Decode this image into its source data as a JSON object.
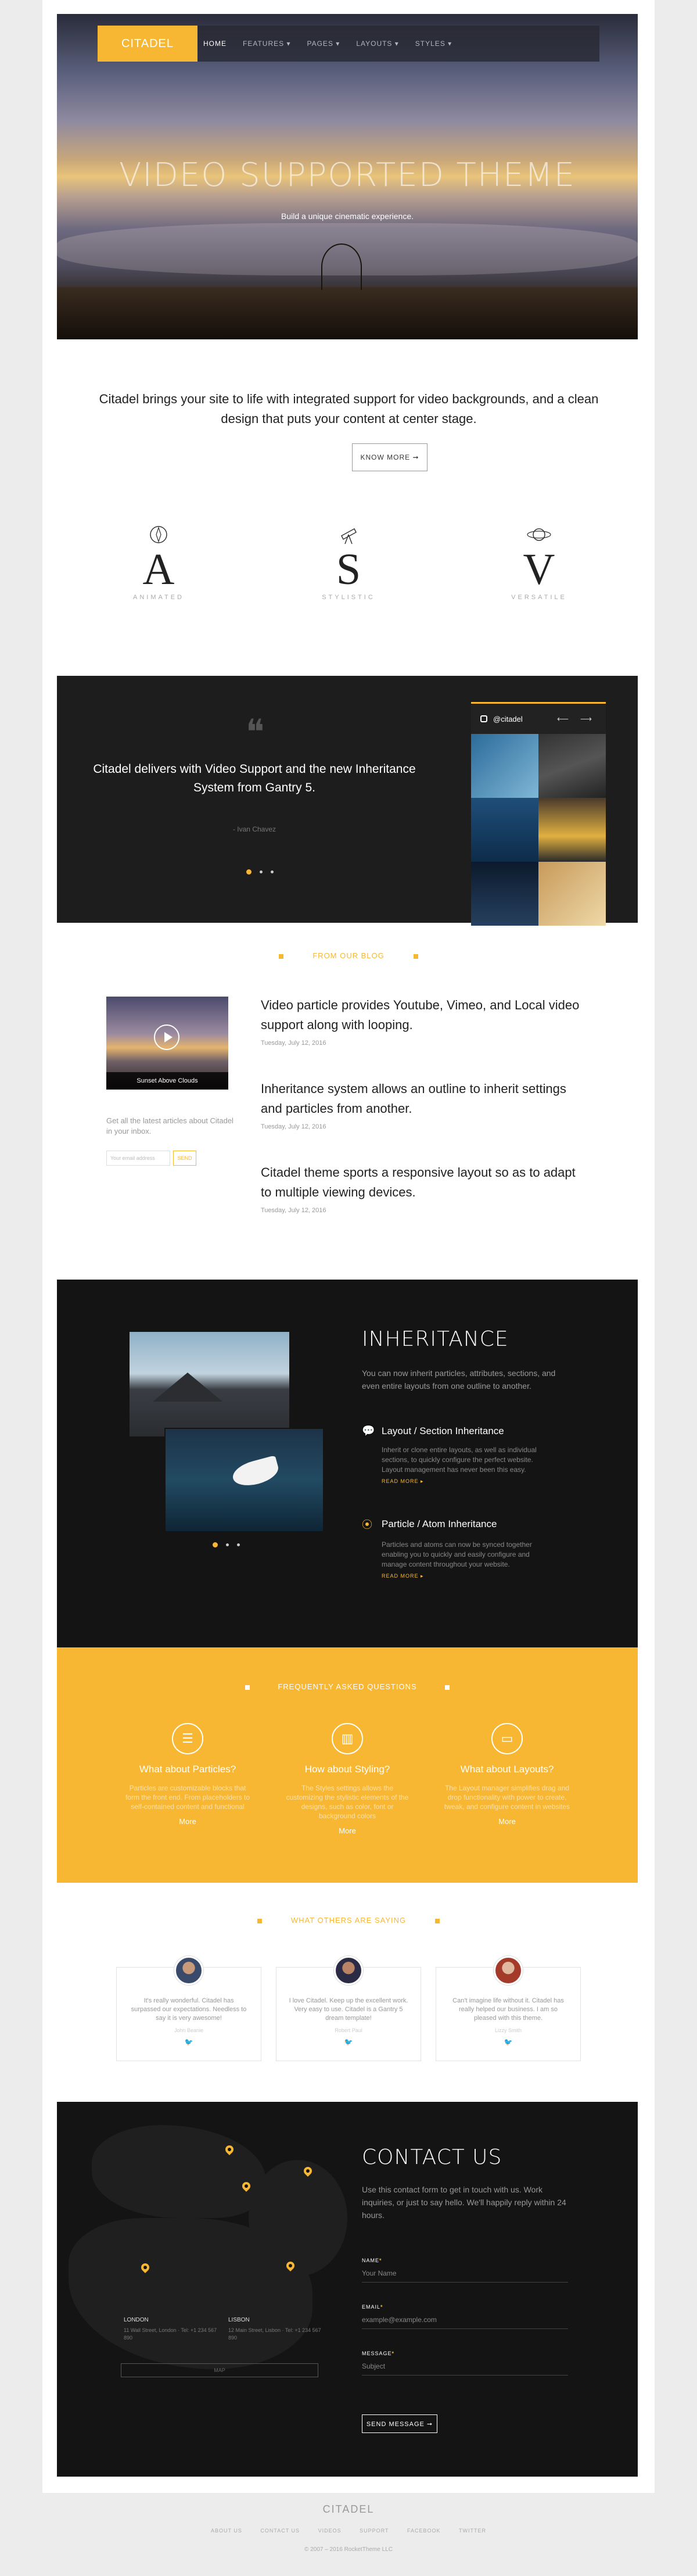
{
  "brand": {
    "logo": "CITADEL",
    "accent": "#f7b733"
  },
  "nav": [
    {
      "label": "HOME",
      "active": true
    },
    {
      "label": "FEATURES ▾"
    },
    {
      "label": "PAGES ▾"
    },
    {
      "label": "LAYOUTS ▾"
    },
    {
      "label": "STYLES ▾"
    }
  ],
  "hero": {
    "title": "VIDEO SUPPORTED THEME",
    "subtitle": "Build a unique cinematic experience."
  },
  "intro": {
    "text": "Citadel brings your site to life with integrated support for video backgrounds, and a clean design that puts your content at center stage.",
    "button": "KNOW MORE ➞"
  },
  "features": [
    {
      "letter": "A",
      "label": "ANIMATED",
      "icon": "compass-icon"
    },
    {
      "letter": "S",
      "label": "STYLISTIC",
      "icon": "telescope-icon"
    },
    {
      "letter": "V",
      "label": "VERSATILE",
      "icon": "planet-icon"
    }
  ],
  "quote": {
    "mark": "❝",
    "text": "Citadel delivers with Video Support and the new Inheritance System from Gantry 5.",
    "author": "- Ivan Chavez"
  },
  "instagram": {
    "handle": "@citadel",
    "arrows": "⟵ ⟶"
  },
  "blog": {
    "heading": "FROM OUR BLOG",
    "image_caption": "Sunset Above Clouds",
    "note": "Get all the latest articles about Citadel in your inbox.",
    "email_placeholder": "Your email address",
    "send": "SEND",
    "posts": [
      {
        "title": "Video particle provides Youtube, Vimeo, and Local video support along with looping.",
        "date": "Tuesday, July 12, 2016"
      },
      {
        "title": "Inheritance system allows an outline to inherit settings and particles from another.",
        "date": "Tuesday, July 12, 2016"
      },
      {
        "title": "Citadel theme sports a responsive layout so as to adapt to multiple viewing devices.",
        "date": "Tuesday, July 12, 2016"
      }
    ]
  },
  "inheritance": {
    "title": "INHERITANCE",
    "desc": "You can now inherit particles, attributes, sections, and even entire layouts from one outline to another.",
    "items": [
      {
        "title": "Layout / Section Inheritance",
        "body": "Inherit or clone entire layouts, as well as individual sections, to quickly configure the perfect website. Layout management has never been this easy.",
        "more": "READ MORE ▸"
      },
      {
        "title": "Particle / Atom Inheritance",
        "body": "Particles and atoms can now be synced together enabling you to quickly and easily configure and manage content throughout your website.",
        "more": "READ MORE ▸"
      }
    ]
  },
  "faq": {
    "heading": "FREQUENTLY ASKED QUESTIONS",
    "items": [
      {
        "title": "What about Particles?",
        "body": "Particles are customizable blocks that form the front end. From placeholders to self-contained content and functional",
        "more": "More",
        "icon": "list-icon"
      },
      {
        "title": "How about Styling?",
        "body": "The Styles settings allows the customizing the stylistic elements of the designs, such as color, font or background colors",
        "more": "More",
        "icon": "bar-chart-icon"
      },
      {
        "title": "What about Layouts?",
        "body": "The Layout manager simplifies drag and drop functionality with power to create, tweak, and configure content in websites",
        "more": "More",
        "icon": "monitor-icon"
      }
    ]
  },
  "testimonials": {
    "heading": "WHAT OTHERS ARE SAYING",
    "items": [
      {
        "text": "It's really wonderful. Citadel has surpassed our expectations. Needless to say it is very awesome!",
        "name": "John Beanie"
      },
      {
        "text": "I love Citadel. Keep up the excellent work. Very easy to use. Citadel is a Gantry 5 dream template!",
        "name": "Robert Paul"
      },
      {
        "text": "Can't imagine life without it. Citadel has really helped our business. I am so pleased with this theme.",
        "name": "Lizzy Smith"
      }
    ]
  },
  "contact": {
    "title": "CONTACT US",
    "desc": "Use this contact form to get in touch with us. Work inquiries, or just to say hello. We'll happily reply within 24 hours.",
    "offices": [
      {
        "city": "LONDON",
        "detail": "11 Wall Street, London · Tel: +1 234 567 890"
      },
      {
        "city": "LISBON",
        "detail": "12 Main Street, Lisbon · Tel: +1 234 567 890"
      }
    ],
    "map_button": "MAP",
    "fields": [
      {
        "label": "NAME",
        "value": "Your Name"
      },
      {
        "label": "EMAIL",
        "value": "example@example.com"
      },
      {
        "label": "MESSAGE",
        "value": "Subject"
      }
    ],
    "send": "SEND MESSAGE ➞"
  },
  "footer": {
    "logo": "CITADEL",
    "links": [
      "ABOUT US",
      "CONTACT US",
      "VIDEOS",
      "SUPPORT",
      "FACEBOOK",
      "TWITTER"
    ],
    "copyright": "© 2007 – 2016 RocketTheme LLC"
  }
}
